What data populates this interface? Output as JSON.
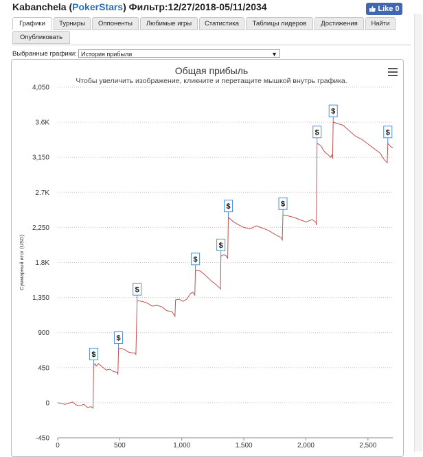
{
  "header": {
    "player": "Kabanchela",
    "site": "PokerStars",
    "filter": "Фильтр:12/27/2018-05/11/2034",
    "like_label": "Like 0"
  },
  "tabs": [
    {
      "label": "Графики",
      "active": true
    },
    {
      "label": "Турниры"
    },
    {
      "label": "Оппоненты"
    },
    {
      "label": "Любимые игры"
    },
    {
      "label": "Статистика"
    },
    {
      "label": "Таблицы лидеров"
    },
    {
      "label": "Достижения"
    },
    {
      "label": "Найти"
    },
    {
      "label": "Опубликовать"
    }
  ],
  "selector": {
    "label": "Выбранные графики:",
    "value": "История прибыли"
  },
  "chart_data": {
    "type": "line",
    "title": "Общая прибыль",
    "subtitle": "Чтобы увеличить изображение, кликните и перетащите мышкой внутрь графика.",
    "ylabel": "Суммарный итог (USD)",
    "xlabel": "",
    "xlim": [
      0,
      2700
    ],
    "ylim": [
      -450,
      4050
    ],
    "y_ticks": [
      "-450",
      "0",
      "450",
      "900",
      "1,350",
      "1.8K",
      "2,250",
      "2.7K",
      "3,150",
      "3.6K",
      "4,050"
    ],
    "y_tick_values": [
      -450,
      0,
      450,
      900,
      1350,
      1800,
      2250,
      2700,
      3150,
      3600,
      4050
    ],
    "x_ticks": [
      "0",
      "500",
      "1,000",
      "1,500",
      "2,000",
      "2,500"
    ],
    "x_tick_values": [
      0,
      500,
      1000,
      1500,
      2000,
      2500
    ],
    "grid": "horizontal-dotted",
    "line_color": "#c0504d",
    "series": [
      {
        "points": [
          [
            0,
            0
          ],
          [
            30,
            -10
          ],
          [
            60,
            -20
          ],
          [
            90,
            -5
          ],
          [
            120,
            10
          ],
          [
            150,
            -30
          ],
          [
            180,
            -40
          ],
          [
            210,
            -20
          ],
          [
            240,
            -60
          ],
          [
            270,
            -50
          ],
          [
            285,
            -70
          ],
          [
            290,
            480
          ],
          [
            300,
            500
          ],
          [
            310,
            470
          ],
          [
            330,
            500
          ],
          [
            360,
            460
          ],
          [
            390,
            420
          ],
          [
            420,
            430
          ],
          [
            450,
            400
          ],
          [
            480,
            390
          ],
          [
            485,
            360
          ],
          [
            490,
            690
          ],
          [
            510,
            700
          ],
          [
            540,
            680
          ],
          [
            570,
            650
          ],
          [
            600,
            640
          ],
          [
            620,
            640
          ],
          [
            630,
            620
          ],
          [
            640,
            1310
          ],
          [
            680,
            1300
          ],
          [
            720,
            1280
          ],
          [
            760,
            1240
          ],
          [
            800,
            1250
          ],
          [
            840,
            1230
          ],
          [
            880,
            1180
          ],
          [
            920,
            1170
          ],
          [
            945,
            1110
          ],
          [
            950,
            1320
          ],
          [
            980,
            1330
          ],
          [
            1010,
            1300
          ],
          [
            1040,
            1330
          ],
          [
            1070,
            1400
          ],
          [
            1090,
            1420
          ],
          [
            1105,
            1380
          ],
          [
            1110,
            1700
          ],
          [
            1150,
            1690
          ],
          [
            1200,
            1620
          ],
          [
            1240,
            1560
          ],
          [
            1280,
            1510
          ],
          [
            1300,
            1480
          ],
          [
            1312,
            1460
          ],
          [
            1315,
            1880
          ],
          [
            1340,
            1900
          ],
          [
            1360,
            1880
          ],
          [
            1370,
            1850
          ],
          [
            1375,
            2380
          ],
          [
            1410,
            2330
          ],
          [
            1450,
            2290
          ],
          [
            1500,
            2250
          ],
          [
            1550,
            2230
          ],
          [
            1600,
            2270
          ],
          [
            1650,
            2240
          ],
          [
            1700,
            2210
          ],
          [
            1750,
            2160
          ],
          [
            1800,
            2120
          ],
          [
            1810,
            2090
          ],
          [
            1815,
            2410
          ],
          [
            1850,
            2400
          ],
          [
            1900,
            2380
          ],
          [
            1950,
            2350
          ],
          [
            2000,
            2320
          ],
          [
            2050,
            2350
          ],
          [
            2080,
            2320
          ],
          [
            2085,
            2280
          ],
          [
            2090,
            3330
          ],
          [
            2120,
            3300
          ],
          [
            2150,
            3220
          ],
          [
            2180,
            3180
          ],
          [
            2200,
            3150
          ],
          [
            2210,
            3180
          ],
          [
            2215,
            3130
          ],
          [
            2220,
            3600
          ],
          [
            2260,
            3580
          ],
          [
            2300,
            3560
          ],
          [
            2350,
            3490
          ],
          [
            2400,
            3420
          ],
          [
            2450,
            3380
          ],
          [
            2500,
            3320
          ],
          [
            2550,
            3260
          ],
          [
            2600,
            3200
          ],
          [
            2630,
            3120
          ],
          [
            2655,
            3080
          ],
          [
            2660,
            3330
          ],
          [
            2680,
            3290
          ],
          [
            2700,
            3270
          ]
        ]
      }
    ],
    "markers": [
      {
        "label": "$",
        "x": 290,
        "y": 480
      },
      {
        "label": "$",
        "x": 490,
        "y": 690
      },
      {
        "label": "$",
        "x": 640,
        "y": 1310
      },
      {
        "label": "$",
        "x": 1110,
        "y": 1700
      },
      {
        "label": "$",
        "x": 1315,
        "y": 1880
      },
      {
        "label": "$",
        "x": 1375,
        "y": 2380
      },
      {
        "label": "$",
        "x": 1815,
        "y": 2410
      },
      {
        "label": "$",
        "x": 2090,
        "y": 3330
      },
      {
        "label": "$",
        "x": 2220,
        "y": 3600
      },
      {
        "label": "$",
        "x": 2660,
        "y": 3330
      }
    ]
  },
  "colors": {
    "brand_link": "#2a6fb5",
    "facebook": "#4267b2",
    "marker_border": "#4a90d9"
  }
}
